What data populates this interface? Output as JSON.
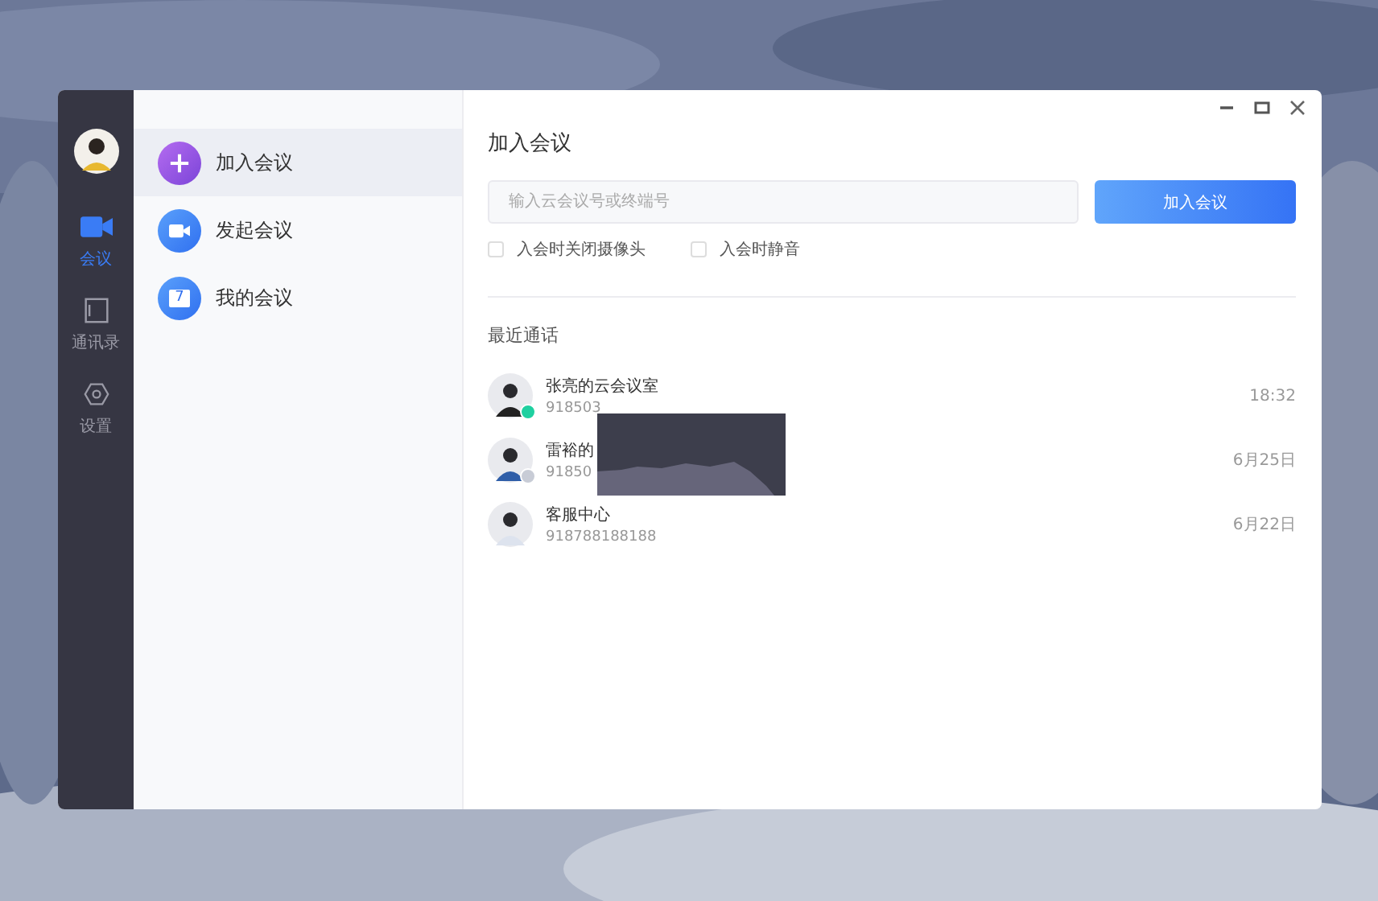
{
  "nav": [
    {
      "label": "会议",
      "kind": "video",
      "selected": true
    },
    {
      "label": "通讯录",
      "kind": "book",
      "selected": false
    },
    {
      "label": "设置",
      "kind": "gear",
      "selected": false
    }
  ],
  "menu": [
    {
      "label": "加入会议",
      "kind": "plus",
      "selected": true
    },
    {
      "label": "发起会议",
      "kind": "video",
      "selected": false
    },
    {
      "label": "我的会议",
      "kind": "calendar",
      "selected": false
    }
  ],
  "calendar_icon_text": "7",
  "title": "加入会议",
  "meeting_field": {
    "placeholder": "输入云会议号或终端号"
  },
  "join_button": "加入会议",
  "options": [
    {
      "label": "入会时关闭摄像头",
      "checked": false
    },
    {
      "label": "入会时静音",
      "checked": false
    }
  ],
  "recent_title": "最近通话",
  "calls": [
    {
      "name": "张亮的云会议室",
      "number": "918503",
      "time": "18:32",
      "color": "#1fd0a0"
    },
    {
      "name": "雷裕的",
      "number": "91850",
      "time": "6月25日",
      "color": "#c8ccd6"
    },
    {
      "name": "客服中心",
      "number": "918788188188",
      "time": "6月22日"
    }
  ]
}
